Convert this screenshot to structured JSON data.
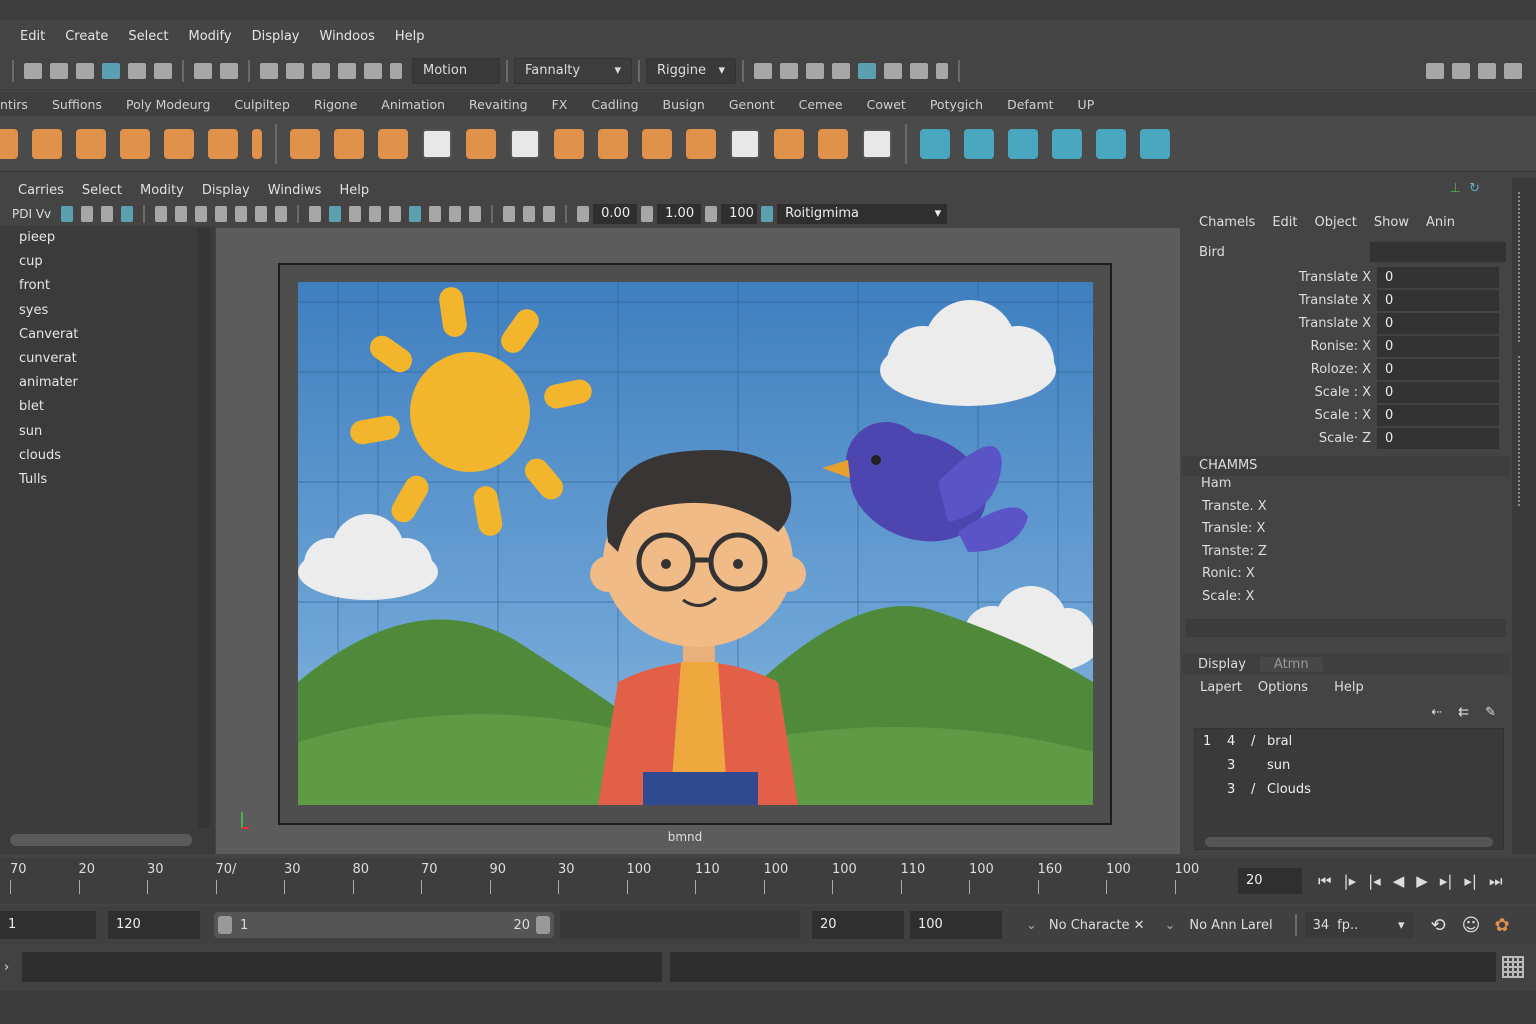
{
  "menu": [
    "Edit",
    "Create",
    "Select",
    "Modify",
    "Display",
    "Windoos",
    "Help"
  ],
  "status": {
    "mode": "Motion",
    "preset": "Fannalty",
    "module": "Riggine"
  },
  "shelf_tabs": [
    "ntirs",
    "Suffions",
    "Poly Modeurg",
    "Culpiltep",
    "Rigone",
    "Animation",
    "Revaiting",
    "FX",
    "Cadling",
    "Busign",
    "Genont",
    "Cemee",
    "Cowet",
    "Potygich",
    "Defamt",
    "UP"
  ],
  "viewport": {
    "menu": [
      "Carries",
      "Select",
      "Modity",
      "Display",
      "Windiws",
      "Help"
    ],
    "tool_label": "PDI Vv",
    "near": "0.00",
    "far": "1.00",
    "exposure": "100",
    "renderer": "Roitigmima",
    "caption": "bmnd"
  },
  "outliner": [
    "pieep",
    "cup",
    "front",
    "syes",
    "Canverat",
    "cunverat",
    "animater",
    "blet",
    "sun",
    "clouds",
    "Tulls"
  ],
  "channel_box": {
    "menu": [
      "Chamels",
      "Edit",
      "Object",
      "Show",
      "Anin"
    ],
    "object": "Bird",
    "attrs": [
      {
        "label": "Translate X",
        "value": "0"
      },
      {
        "label": "Translate X",
        "value": "0"
      },
      {
        "label": "Translate X",
        "value": "0"
      },
      {
        "label": "Ronise: X",
        "value": "0"
      },
      {
        "label": "Roloze: X",
        "value": "0"
      },
      {
        "label": "Scale : X",
        "value": "0"
      },
      {
        "label": "Scale : X",
        "value": "0"
      },
      {
        "label": "Scale· Z",
        "value": "0"
      }
    ],
    "shapes_header": "CHAMMS",
    "shapes": [
      "Ham",
      "Transte. X",
      "Transle: X",
      "Transte: Z",
      "Ronic: X",
      "Scale: X"
    ]
  },
  "layers": {
    "tabs": [
      "Display",
      "Atmn"
    ],
    "menu": [
      "Lapert",
      "Options",
      "Help"
    ],
    "rows": [
      {
        "c1": "1",
        "c2": "4",
        "name": "bral"
      },
      {
        "c1": "",
        "c2": "3",
        "name": "sun"
      },
      {
        "c1": "",
        "c2": "3",
        "name": "Clouds"
      }
    ]
  },
  "timeline": {
    "ticks": [
      "70",
      "20",
      "30",
      "70/",
      "30",
      "80",
      "70",
      "90",
      "30",
      "100",
      "110",
      "100",
      "100",
      "110",
      "100",
      "160",
      "100",
      "100"
    ],
    "current": "20"
  },
  "range": {
    "start": "1",
    "end": "120",
    "inner_start": "1",
    "inner_end": "20",
    "play_start": "20",
    "play_end": "100",
    "character": "No Characte",
    "anim_layer": "No Ann Larel",
    "fps": "34",
    "fps_unit": "fp.."
  }
}
